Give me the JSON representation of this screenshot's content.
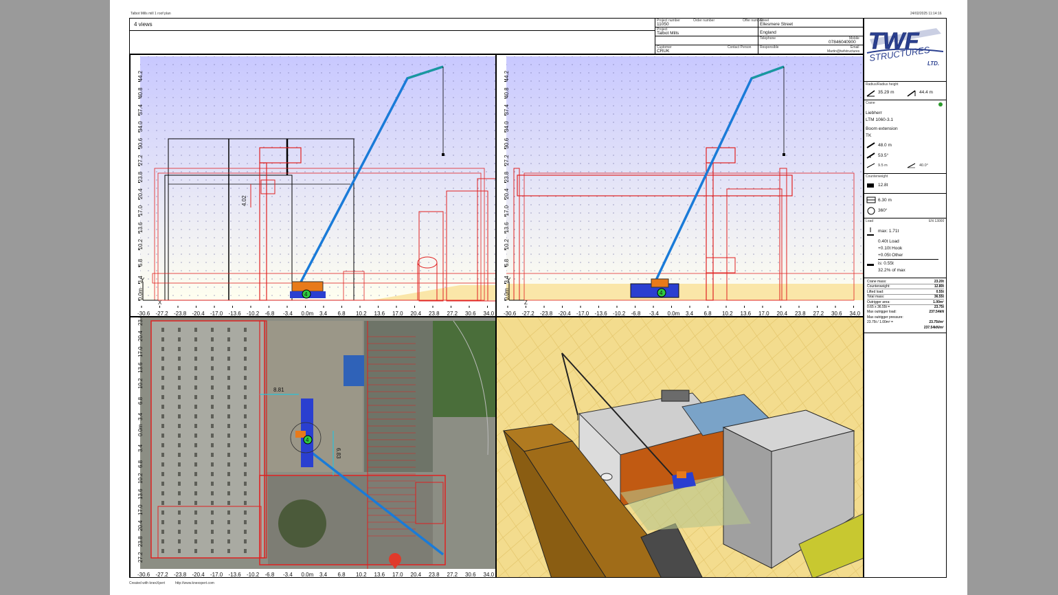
{
  "doc": {
    "title": "Talbot Mills mill 1 roof plan",
    "timestamp": "24/02/2025 11:14:16",
    "views_label": "4 views",
    "footer_created": "Created with knexXpert",
    "footer_url": "http://www.knexxpert.com"
  },
  "header": {
    "project_number_label": "Project number",
    "project_number": "11050",
    "order_number_label": "Order number",
    "offer_number_label": "Offer number",
    "project_label": "Project",
    "project": "Talbot Mills",
    "customer_label": "Customer",
    "customer": "CRUK",
    "contact_person_label": "Contact Person",
    "street_label": "Street",
    "street": "Ellesmere Street",
    "country": "England",
    "telephone_label": "Telephone",
    "telephone": "07846040900",
    "mobile_label": "Mobile",
    "responsible_label": "Responsible",
    "email_label": "Email",
    "email": "Martin@twfstructures"
  },
  "brand": {
    "logo_main": "TWF",
    "logo_sub": "STRUCTURES",
    "logo_ltd": "LTD.",
    "color": "#2a3f8f"
  },
  "crane": {
    "radius_label": "Radius/Radius height",
    "radius": "35.29 m",
    "height": "44.4 m",
    "section_label": "Crane",
    "maker": "Liebherr",
    "model": "LTM 1060-3.1",
    "config1": "Boom extension",
    "config2": "TK",
    "boom_length": "48.0 m",
    "boom_angle": "53.5°",
    "jib_length": "9.5 m",
    "jib_angle": "40.0°",
    "counterweight_label": "Counterweight",
    "counterweight": "12.8t",
    "support_base": "6.30 m",
    "slewing": "360°"
  },
  "load": {
    "label": "Load",
    "standard": "EN 13000",
    "max": "max: 1.71t",
    "load_line": "0.40t Load",
    "hook_line": "+0.10t Hook",
    "other_line": "+0.05t Other",
    "is_line": "is: 0.55t",
    "percent_line": "32.2% of max"
  },
  "masses": [
    {
      "label": "Crane mass:",
      "value": "23.20t"
    },
    {
      "label": "Counterweight:",
      "value": "12.80t"
    },
    {
      "label": "Lifted load:",
      "value": "0.55t"
    },
    {
      "label": "Total mass:",
      "value": "36.55t"
    },
    {
      "label": "Outrigger area:",
      "value": "1.00m²"
    },
    {
      "label": "0.65 x 36.55t =",
      "value": "23.75t"
    },
    {
      "label": "Max outrigger load:",
      "value": "237.54kN"
    },
    {
      "label": "Max outrigger pressure:",
      "value": ""
    },
    {
      "label": "23.75t / 1.00m² =",
      "value": "23.75t/m²"
    },
    {
      "label": "",
      "value": "237.54kN/m²"
    }
  ],
  "elevation": {
    "y_ticks": [
      "0.0m",
      "3.4",
      "6.8",
      "10.2",
      "13.6",
      "17.0",
      "20.4",
      "23.8",
      "27.2",
      "30.6",
      "34.0",
      "37.4",
      "40.8",
      "44.2"
    ],
    "x_ticks": [
      "-30.6",
      "-27.2",
      "-23.8",
      "-20.4",
      "-17.0",
      "-13.6",
      "-10.2",
      "-6.8",
      "-3.4",
      "0.0m",
      "3.4",
      "6.8",
      "10.2",
      "13.6",
      "17.0",
      "20.4",
      "23.8",
      "27.2",
      "30.6",
      "34.0"
    ],
    "dim_label": "4.02",
    "axis_x": "X",
    "axis_y": "Y",
    "axis_z": "Z",
    "crane_number": "4"
  },
  "plan": {
    "y_ticks": [
      "23.8",
      "20.4",
      "17.0",
      "13.6",
      "10.2",
      "6.8",
      "3.4",
      "0.0m",
      "3.4",
      "6.8",
      "10.2",
      "13.6",
      "17.0",
      "20.4",
      "23.8",
      "27.2"
    ],
    "dim1": "8.81",
    "dim2": "6.83"
  }
}
